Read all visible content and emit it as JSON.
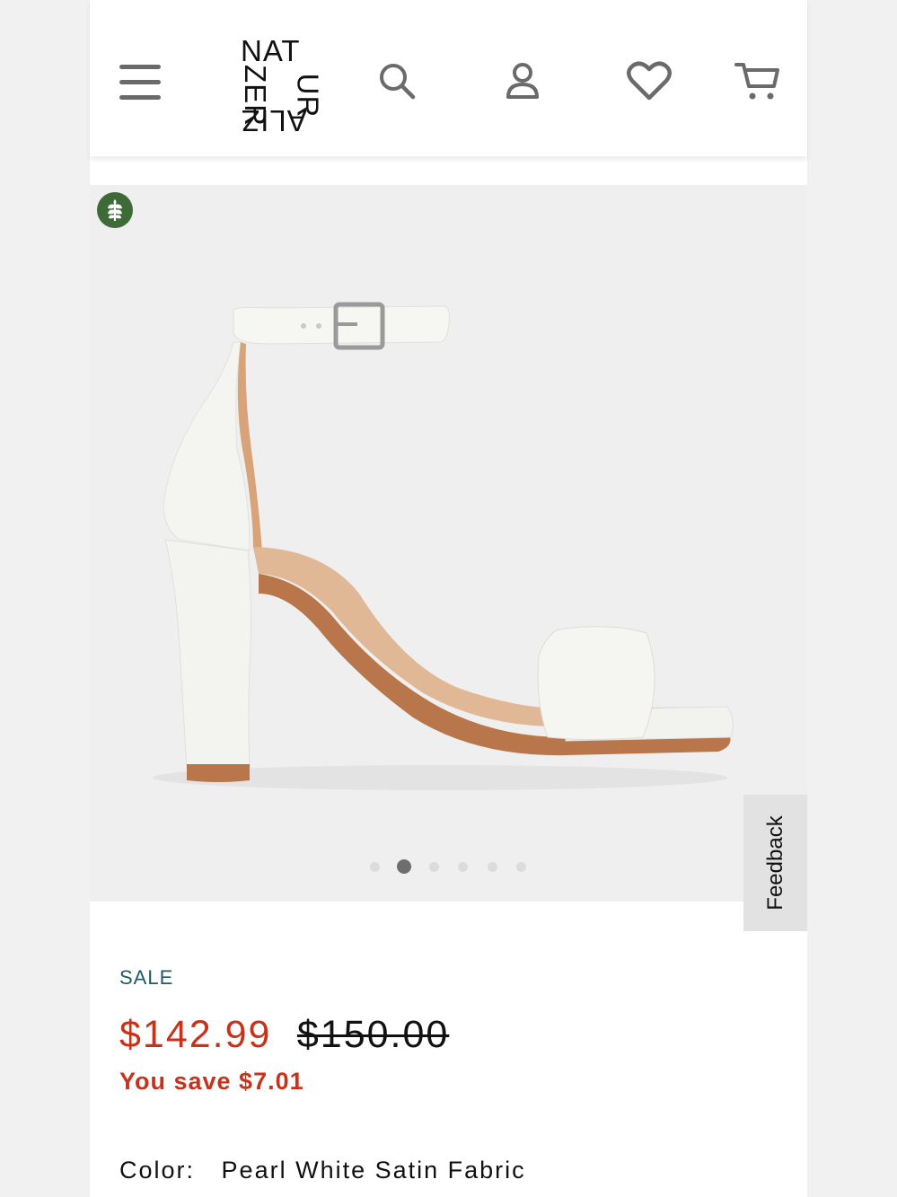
{
  "header": {
    "brand_top": "NAT",
    "brand_left": "ZER",
    "brand_right": "UR",
    "brand_bottom": "ALIZ",
    "icons": [
      "menu-icon",
      "search-icon",
      "account-icon",
      "heart-icon",
      "cart-icon"
    ]
  },
  "gallery": {
    "badge_icon": "leaf-icon",
    "badge_color": "#3d6a37",
    "dot_count": 6,
    "active_dot": 2
  },
  "feedback": {
    "label": "Feedback"
  },
  "product": {
    "sale_label": "SALE",
    "price_now": "$142.99",
    "price_was": "$150.00",
    "savings": "You save $7.01",
    "color_label": "Color:",
    "color_value": "Pearl White Satin Fabric"
  },
  "colors": {
    "sale_price": "#c8321a",
    "sale_label": "#1c5a6b",
    "badge": "#3d6a37"
  }
}
